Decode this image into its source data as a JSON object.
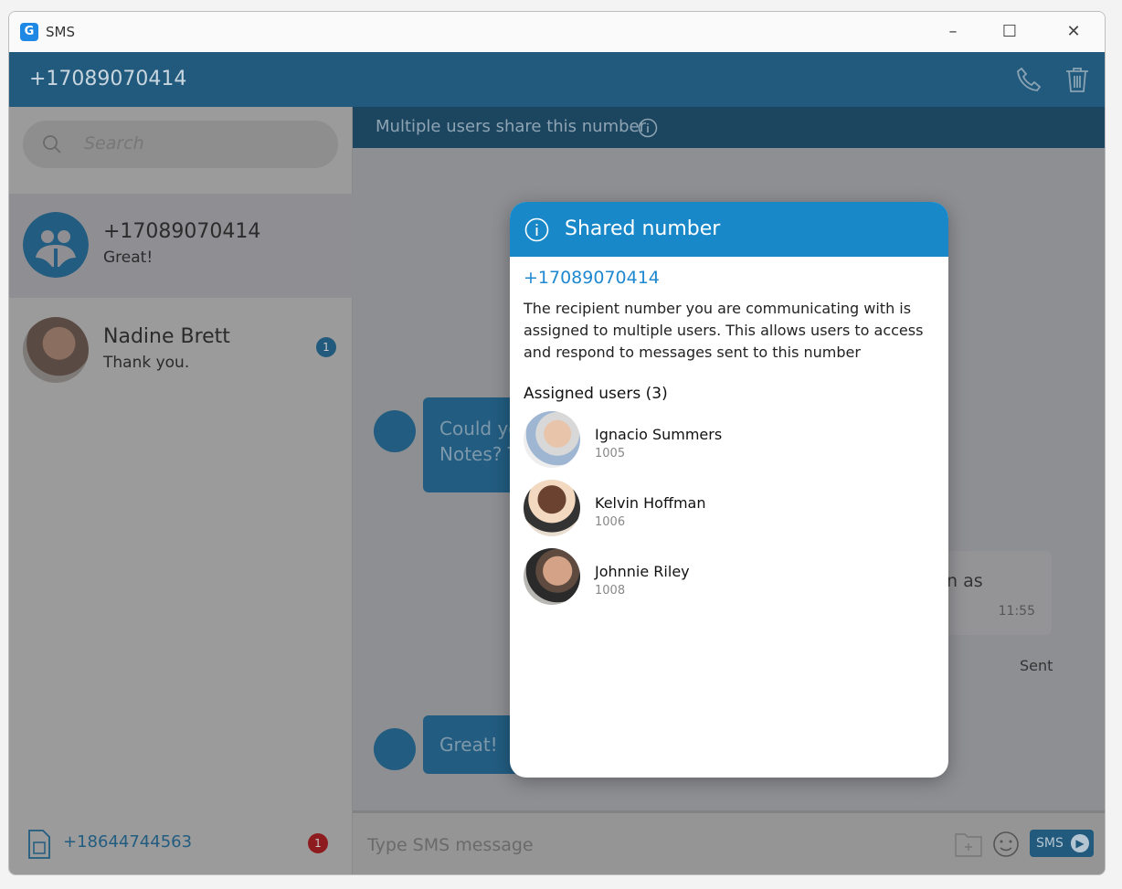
{
  "window": {
    "title": "SMS",
    "logo": "G"
  },
  "header": {
    "number": "+17089070414",
    "icons": [
      "phone-icon",
      "trash-icon"
    ]
  },
  "sidebar": {
    "search_placeholder": "Search",
    "conversations": [
      {
        "name": "+17089070414",
        "last": "Great!",
        "selected": true
      },
      {
        "name": "Nadine Brett",
        "last": "Thank you.",
        "unread": "1"
      }
    ],
    "footer": {
      "number": "+18644744563",
      "badge": "1"
    }
  },
  "chat": {
    "banner": "Multiple users share this number",
    "messages": [
      {
        "text1": "Could yo",
        "text2": "Notes? T"
      },
      {
        "text": "n as",
        "time": "11:55",
        "status": "Sent"
      },
      {
        "text": "Great!"
      }
    ],
    "input_placeholder": "Type SMS message",
    "send_label": "SMS"
  },
  "modal": {
    "title": "Shared number",
    "number": "+17089070414",
    "description": "The recipient number you are communicating with is assigned to multiple users. This allows users to access and respond to messages sent to this number",
    "assigned_label": "Assigned users (3)",
    "users": [
      {
        "name": "Ignacio Summers",
        "ext": "1005"
      },
      {
        "name": "Kelvin Hoffman",
        "ext": "1006"
      },
      {
        "name": "Johnnie Riley",
        "ext": "1008"
      }
    ]
  },
  "colors": {
    "header": "#215a7c",
    "modal_header": "#1888c9",
    "accent": "#1e88d0",
    "badge": "#b02024"
  }
}
